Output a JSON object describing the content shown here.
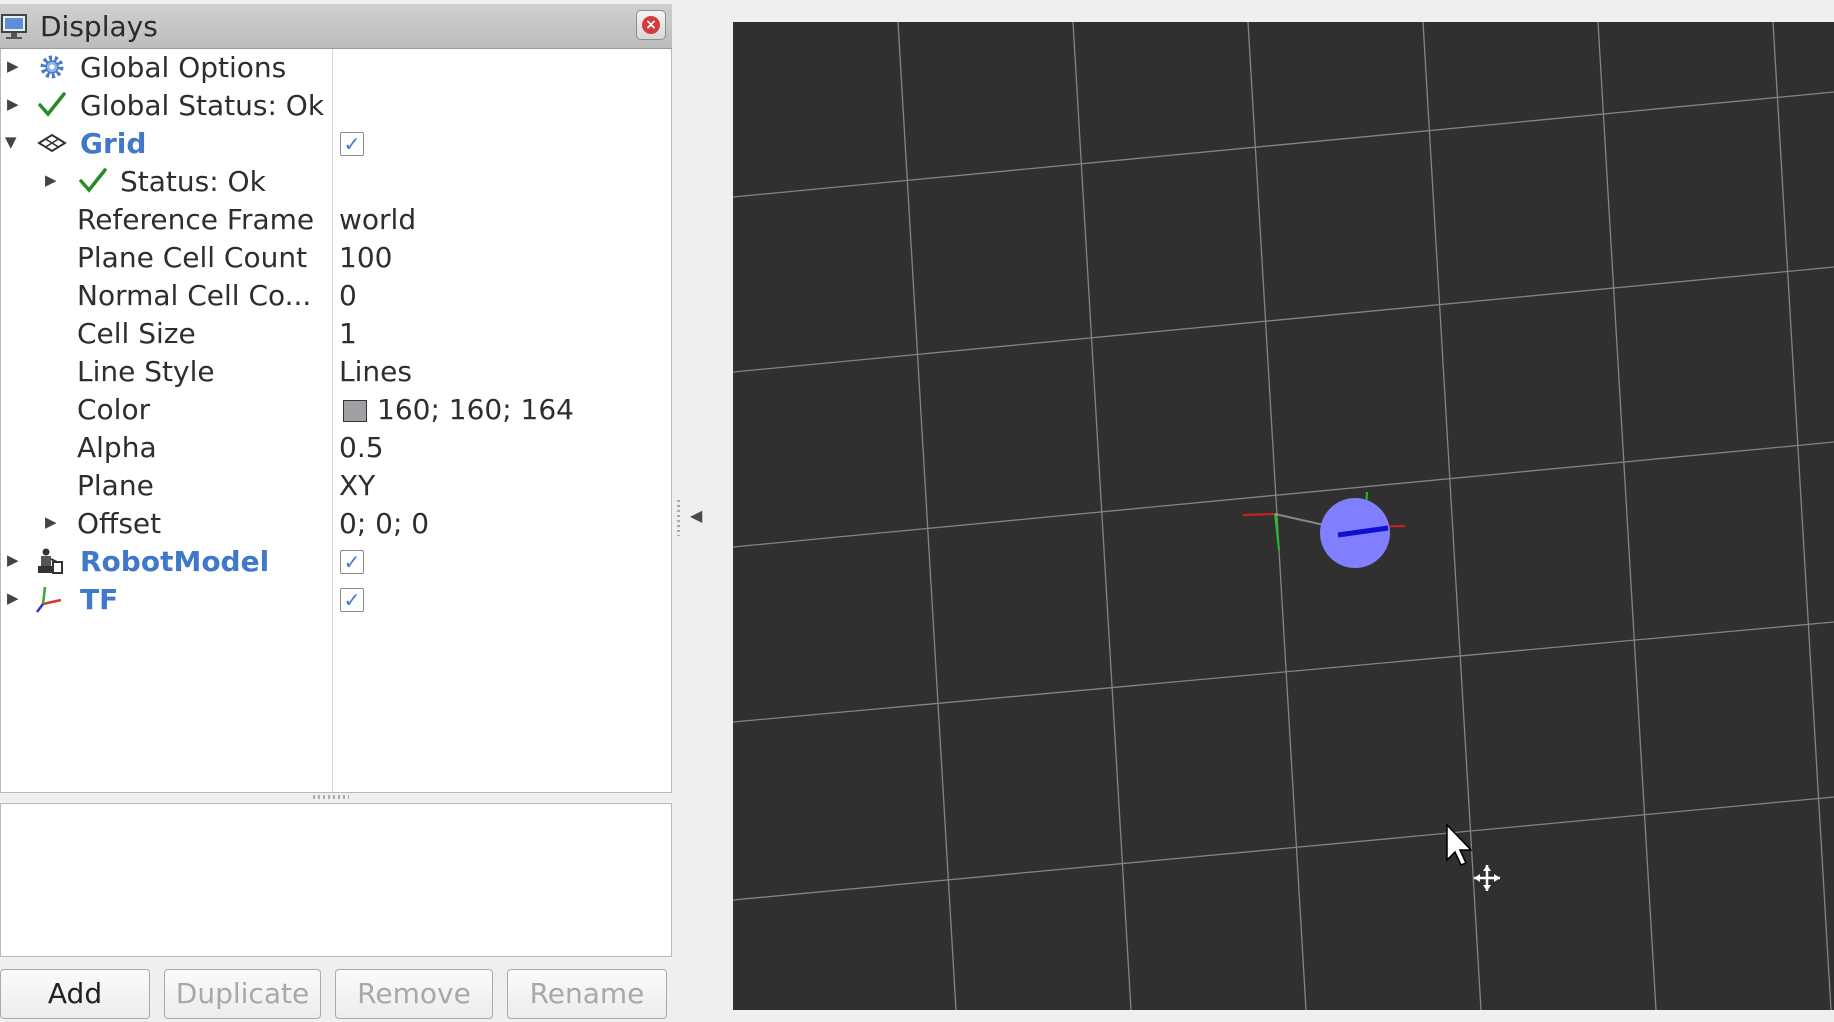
{
  "panel": {
    "title": "Displays",
    "title_icon": "monitor-icon",
    "close_icon": "close-icon"
  },
  "tree": {
    "rows": [
      {
        "name": "Global Options",
        "icon": "gear-icon",
        "expander": "collapsed"
      },
      {
        "name": "Global Status: Ok",
        "icon": "check-icon",
        "expander": "collapsed"
      },
      {
        "name": "Grid",
        "icon": "grid-icon",
        "expander": "expanded",
        "checked": true
      },
      {
        "name": "Status: Ok",
        "icon": "check-icon",
        "expander": "collapsed"
      },
      {
        "name": "Reference Frame",
        "value": "world"
      },
      {
        "name": "Plane Cell Count",
        "value": "100"
      },
      {
        "name": "Normal Cell Co...",
        "value": "0"
      },
      {
        "name": "Cell Size",
        "value": "1"
      },
      {
        "name": "Line Style",
        "value": "Lines"
      },
      {
        "name": "Color",
        "value": "160; 160; 164",
        "swatch": "#a0a0a4"
      },
      {
        "name": "Alpha",
        "value": "0.5"
      },
      {
        "name": "Plane",
        "value": "XY"
      },
      {
        "name": "Offset",
        "value": "0; 0; 0",
        "expander": "collapsed"
      },
      {
        "name": "RobotModel",
        "icon": "robot-icon",
        "expander": "collapsed",
        "checked": true
      },
      {
        "name": "TF",
        "icon": "axes-icon",
        "expander": "collapsed",
        "checked": true
      }
    ]
  },
  "buttons": {
    "add": "Add",
    "duplicate": "Duplicate",
    "remove": "Remove",
    "rename": "Rename"
  },
  "viewport": {
    "background": "#303030",
    "grid_color": "#a0a0a4",
    "robot_color": "#7f7fff",
    "cursor_icon": "move-cursor-icon"
  },
  "colors": {
    "accent": "#3f79c8",
    "status_ok": "#2a8a2a"
  }
}
